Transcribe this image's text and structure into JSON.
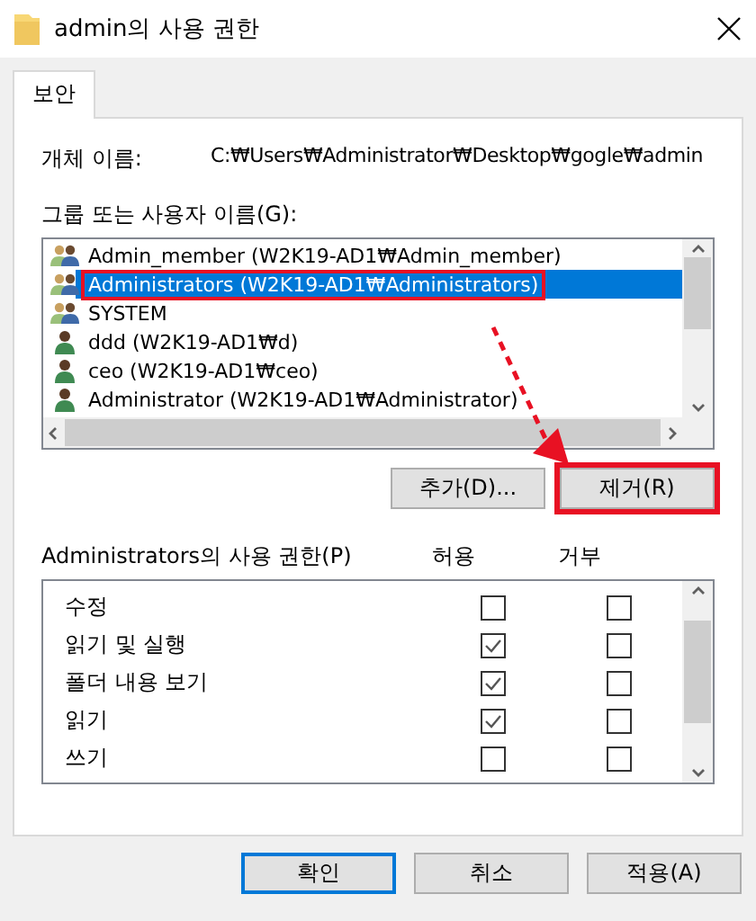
{
  "window": {
    "title": "admin의 사용 권한"
  },
  "tabs": [
    {
      "label": "보안",
      "selected": true
    }
  ],
  "object_name": {
    "label": "개체 이름:",
    "value": "C:₩Users₩Administrator₩Desktop₩gogle₩admin"
  },
  "users": {
    "label": "그룹 또는 사용자 이름(G):",
    "items": [
      {
        "kind": "group",
        "name": "Admin_member (W2K19-AD1₩Admin_member)",
        "selected": false,
        "highlighted": false
      },
      {
        "kind": "group",
        "name": "Administrators (W2K19-AD1₩Administrators)",
        "selected": true,
        "highlighted": true
      },
      {
        "kind": "group",
        "name": "SYSTEM",
        "selected": false,
        "highlighted": false
      },
      {
        "kind": "user",
        "name": "ddd (W2K19-AD1₩d)",
        "selected": false,
        "highlighted": false
      },
      {
        "kind": "user",
        "name": "ceo (W2K19-AD1₩ceo)",
        "selected": false,
        "highlighted": false
      },
      {
        "kind": "user",
        "name": "Administrator (W2K19-AD1₩Administrator)",
        "selected": false,
        "highlighted": false
      }
    ]
  },
  "user_buttons": [
    {
      "label": "추가(D)...",
      "highlighted": false
    },
    {
      "label": "제거(R)",
      "highlighted": true
    }
  ],
  "annotation_arrow": true,
  "permissions": {
    "label": "Administrators의 사용 권한(P)",
    "allow_header": "허용",
    "deny_header": "거부",
    "rows": [
      {
        "name": "수정",
        "allow": false,
        "deny": false
      },
      {
        "name": "읽기 및 실행",
        "allow": true,
        "deny": false
      },
      {
        "name": "폴더 내용 보기",
        "allow": true,
        "deny": false
      },
      {
        "name": "읽기",
        "allow": true,
        "deny": false
      },
      {
        "name": "쓰기",
        "allow": false,
        "deny": false
      }
    ]
  },
  "buttons": [
    {
      "label": "확인",
      "default": true
    },
    {
      "label": "취소",
      "default": false
    },
    {
      "label": "적용(A)",
      "default": false
    }
  ]
}
